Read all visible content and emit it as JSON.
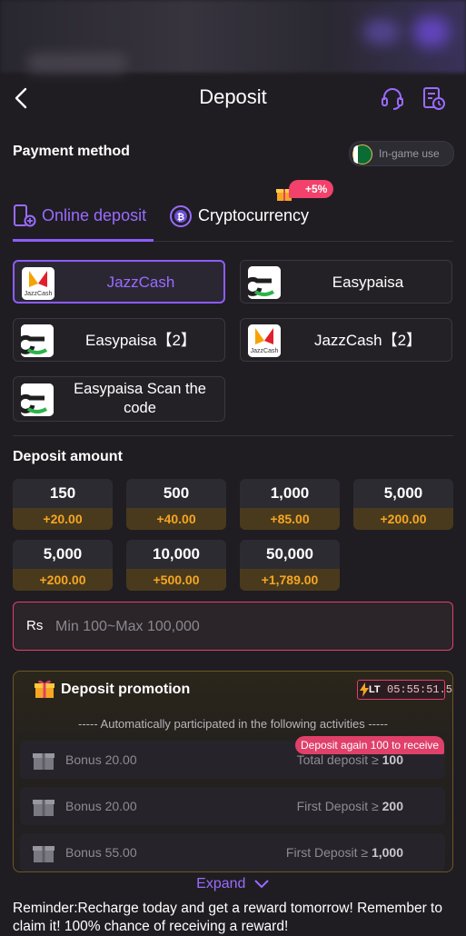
{
  "header": {
    "title": "Deposit"
  },
  "payment": {
    "label": "Payment method",
    "ingame": "In-game use"
  },
  "tabs": [
    {
      "label": "Online deposit",
      "active": true
    },
    {
      "label": "Cryptocurrency",
      "badge": "+5%"
    }
  ],
  "methods": [
    {
      "name": "JazzCash",
      "logo": "jazzcash-logo",
      "selected": true
    },
    {
      "name": "Easypaisa",
      "logo": "easypaisa-logo"
    },
    {
      "name": "Easypaisa【2】",
      "logo": "easypaisa-logo"
    },
    {
      "name": "JazzCash【2】",
      "logo": "jazzcash-logo"
    },
    {
      "name": "Easypaisa Scan the code",
      "logo": "easypaisa-logo"
    }
  ],
  "amount": {
    "label": "Deposit amount",
    "options": [
      {
        "value": "150",
        "bonus": "+20.00"
      },
      {
        "value": "500",
        "bonus": "+40.00"
      },
      {
        "value": "1,000",
        "bonus": "+85.00"
      },
      {
        "value": "5,000",
        "bonus": "+200.00"
      },
      {
        "value": "5,000",
        "bonus": "+200.00"
      },
      {
        "value": "10,000",
        "bonus": "+500.00"
      },
      {
        "value": "50,000",
        "bonus": "+1,789.00"
      }
    ],
    "currency": "Rs",
    "placeholder": "Min 100~Max 100,000"
  },
  "promo": {
    "title": "Deposit promotion",
    "timer_tag": "LT",
    "timer": "05:55:51.5",
    "auto_text": "----- Automatically participated in the following activities -----",
    "again_badge": "Deposit again 100 to receive",
    "rows": [
      {
        "bonus": "Bonus 20.00",
        "cond": "Total deposit ≥",
        "amount": "100"
      },
      {
        "bonus": "Bonus 20.00",
        "cond": "First Deposit ≥",
        "amount": "200"
      },
      {
        "bonus": "Bonus 55.00",
        "cond": "First Deposit ≥",
        "amount": "1,000"
      }
    ],
    "expand": "Expand"
  },
  "reminder": "Reminder:Recharge today and get a reward tomorrow! Remember to claim it! 100% chance of receiving a reward!",
  "colors": {
    "accent": "#8d5cff",
    "bonus": "#f5a623",
    "alert": "#e0406a"
  }
}
